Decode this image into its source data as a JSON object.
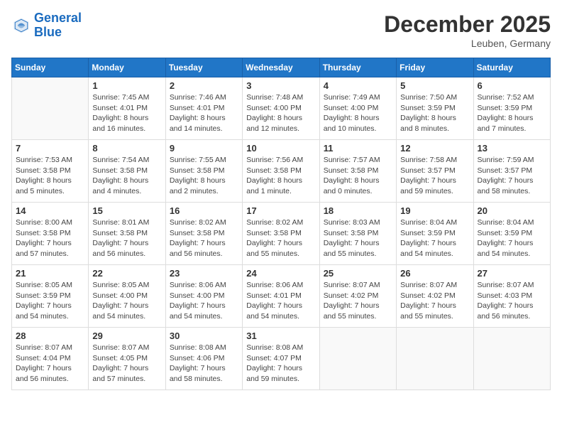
{
  "header": {
    "logo_line1": "General",
    "logo_line2": "Blue",
    "month_title": "December 2025",
    "location": "Leuben, Germany"
  },
  "days_of_week": [
    "Sunday",
    "Monday",
    "Tuesday",
    "Wednesday",
    "Thursday",
    "Friday",
    "Saturday"
  ],
  "weeks": [
    [
      {
        "num": "",
        "info": ""
      },
      {
        "num": "1",
        "info": "Sunrise: 7:45 AM\nSunset: 4:01 PM\nDaylight: 8 hours\nand 16 minutes."
      },
      {
        "num": "2",
        "info": "Sunrise: 7:46 AM\nSunset: 4:01 PM\nDaylight: 8 hours\nand 14 minutes."
      },
      {
        "num": "3",
        "info": "Sunrise: 7:48 AM\nSunset: 4:00 PM\nDaylight: 8 hours\nand 12 minutes."
      },
      {
        "num": "4",
        "info": "Sunrise: 7:49 AM\nSunset: 4:00 PM\nDaylight: 8 hours\nand 10 minutes."
      },
      {
        "num": "5",
        "info": "Sunrise: 7:50 AM\nSunset: 3:59 PM\nDaylight: 8 hours\nand 8 minutes."
      },
      {
        "num": "6",
        "info": "Sunrise: 7:52 AM\nSunset: 3:59 PM\nDaylight: 8 hours\nand 7 minutes."
      }
    ],
    [
      {
        "num": "7",
        "info": "Sunrise: 7:53 AM\nSunset: 3:58 PM\nDaylight: 8 hours\nand 5 minutes."
      },
      {
        "num": "8",
        "info": "Sunrise: 7:54 AM\nSunset: 3:58 PM\nDaylight: 8 hours\nand 4 minutes."
      },
      {
        "num": "9",
        "info": "Sunrise: 7:55 AM\nSunset: 3:58 PM\nDaylight: 8 hours\nand 2 minutes."
      },
      {
        "num": "10",
        "info": "Sunrise: 7:56 AM\nSunset: 3:58 PM\nDaylight: 8 hours\nand 1 minute."
      },
      {
        "num": "11",
        "info": "Sunrise: 7:57 AM\nSunset: 3:58 PM\nDaylight: 8 hours\nand 0 minutes."
      },
      {
        "num": "12",
        "info": "Sunrise: 7:58 AM\nSunset: 3:57 PM\nDaylight: 7 hours\nand 59 minutes."
      },
      {
        "num": "13",
        "info": "Sunrise: 7:59 AM\nSunset: 3:57 PM\nDaylight: 7 hours\nand 58 minutes."
      }
    ],
    [
      {
        "num": "14",
        "info": "Sunrise: 8:00 AM\nSunset: 3:58 PM\nDaylight: 7 hours\nand 57 minutes."
      },
      {
        "num": "15",
        "info": "Sunrise: 8:01 AM\nSunset: 3:58 PM\nDaylight: 7 hours\nand 56 minutes."
      },
      {
        "num": "16",
        "info": "Sunrise: 8:02 AM\nSunset: 3:58 PM\nDaylight: 7 hours\nand 56 minutes."
      },
      {
        "num": "17",
        "info": "Sunrise: 8:02 AM\nSunset: 3:58 PM\nDaylight: 7 hours\nand 55 minutes."
      },
      {
        "num": "18",
        "info": "Sunrise: 8:03 AM\nSunset: 3:58 PM\nDaylight: 7 hours\nand 55 minutes."
      },
      {
        "num": "19",
        "info": "Sunrise: 8:04 AM\nSunset: 3:59 PM\nDaylight: 7 hours\nand 54 minutes."
      },
      {
        "num": "20",
        "info": "Sunrise: 8:04 AM\nSunset: 3:59 PM\nDaylight: 7 hours\nand 54 minutes."
      }
    ],
    [
      {
        "num": "21",
        "info": "Sunrise: 8:05 AM\nSunset: 3:59 PM\nDaylight: 7 hours\nand 54 minutes."
      },
      {
        "num": "22",
        "info": "Sunrise: 8:05 AM\nSunset: 4:00 PM\nDaylight: 7 hours\nand 54 minutes."
      },
      {
        "num": "23",
        "info": "Sunrise: 8:06 AM\nSunset: 4:00 PM\nDaylight: 7 hours\nand 54 minutes."
      },
      {
        "num": "24",
        "info": "Sunrise: 8:06 AM\nSunset: 4:01 PM\nDaylight: 7 hours\nand 54 minutes."
      },
      {
        "num": "25",
        "info": "Sunrise: 8:07 AM\nSunset: 4:02 PM\nDaylight: 7 hours\nand 55 minutes."
      },
      {
        "num": "26",
        "info": "Sunrise: 8:07 AM\nSunset: 4:02 PM\nDaylight: 7 hours\nand 55 minutes."
      },
      {
        "num": "27",
        "info": "Sunrise: 8:07 AM\nSunset: 4:03 PM\nDaylight: 7 hours\nand 56 minutes."
      }
    ],
    [
      {
        "num": "28",
        "info": "Sunrise: 8:07 AM\nSunset: 4:04 PM\nDaylight: 7 hours\nand 56 minutes."
      },
      {
        "num": "29",
        "info": "Sunrise: 8:07 AM\nSunset: 4:05 PM\nDaylight: 7 hours\nand 57 minutes."
      },
      {
        "num": "30",
        "info": "Sunrise: 8:08 AM\nSunset: 4:06 PM\nDaylight: 7 hours\nand 58 minutes."
      },
      {
        "num": "31",
        "info": "Sunrise: 8:08 AM\nSunset: 4:07 PM\nDaylight: 7 hours\nand 59 minutes."
      },
      {
        "num": "",
        "info": ""
      },
      {
        "num": "",
        "info": ""
      },
      {
        "num": "",
        "info": ""
      }
    ]
  ]
}
